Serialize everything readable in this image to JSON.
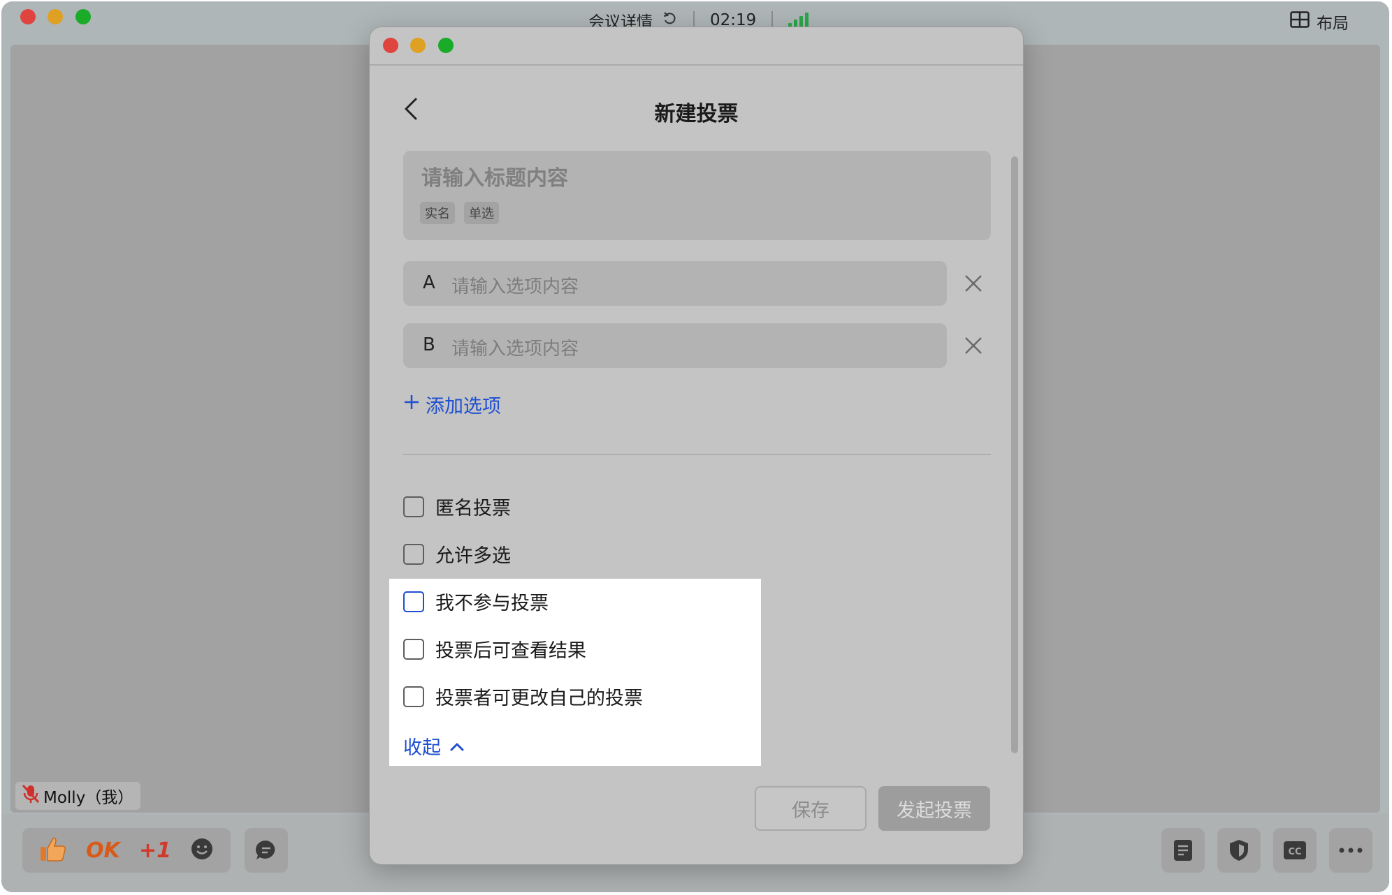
{
  "window": {
    "title": "会议详情",
    "timer": "02:19",
    "layout_label": "布局"
  },
  "participant": {
    "name_tag": "Molly（我）"
  },
  "reactions": [
    "thumbs-up",
    "OK",
    "+1",
    "smiley"
  ],
  "toolbar_right": [
    "notes-icon",
    "shield-icon",
    "cc-icon",
    "more-icon"
  ],
  "dialog": {
    "title": "新建投票",
    "title_placeholder": "请输入标题内容",
    "tags": [
      "实名",
      "单选"
    ],
    "options": [
      {
        "letter": "A",
        "placeholder": "请输入选项内容"
      },
      {
        "letter": "B",
        "placeholder": "请输入选项内容"
      }
    ],
    "add_option_label": "添加选项",
    "checkboxes": [
      {
        "label": "匿名投票",
        "checked": false
      },
      {
        "label": "允许多选",
        "checked": false
      },
      {
        "label": "我不参与投票",
        "checked": false
      },
      {
        "label": "投票后可查看结果",
        "checked": false
      },
      {
        "label": "投票者可更改自己的投票",
        "checked": false
      }
    ],
    "collapse_label": "收起",
    "save_label": "保存",
    "start_label": "发起投票"
  },
  "colors": {
    "accent": "#1f4fd0",
    "signal": "#2aa84a",
    "close": "#e0443e",
    "minimize": "#dea123",
    "maximize": "#1aab29"
  }
}
